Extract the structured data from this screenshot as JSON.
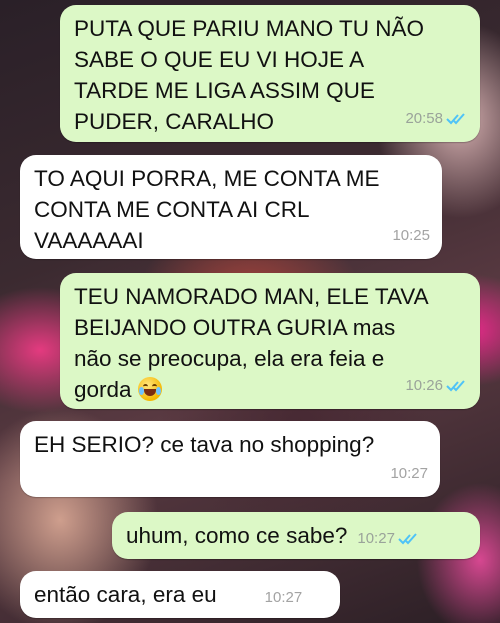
{
  "messages": [
    {
      "id": "m1",
      "direction": "outgoing",
      "text": "PUTA QUE PARIU MANO TU NÃO\nSABE O QUE EU VI HOJE A\nTARDE ME LIGA ASSIM QUE\nPUDER, CARALHO",
      "time": "20:58",
      "status": "read"
    },
    {
      "id": "m2",
      "direction": "incoming",
      "text": "TO AQUI PORRA, ME CONTA ME\nCONTA ME CONTA AI CRL\nVAAAAAAI",
      "time": "10:25"
    },
    {
      "id": "m3",
      "direction": "outgoing",
      "text": "TEU NAMORADO MAN, ELE TAVA\nBEIJANDO OUTRA GURIA mas\nnão se preocupa, ela era feia e\ngorda",
      "emoji": "face-with-tears-of-joy",
      "time": "10:26",
      "status": "read"
    },
    {
      "id": "m4",
      "direction": "incoming",
      "text": "EH SERIO? ce tava no shopping?",
      "time": "10:27"
    },
    {
      "id": "m5",
      "direction": "outgoing",
      "text": "uhum, como ce sabe?",
      "time": "10:27",
      "status": "read"
    },
    {
      "id": "m6",
      "direction": "incoming",
      "text": "então cara, era eu",
      "time": "10:27"
    }
  ],
  "colors": {
    "outgoing_bubble": "#dcf8c6",
    "incoming_bubble": "#ffffff",
    "read_ticks": "#4fc3f7"
  }
}
